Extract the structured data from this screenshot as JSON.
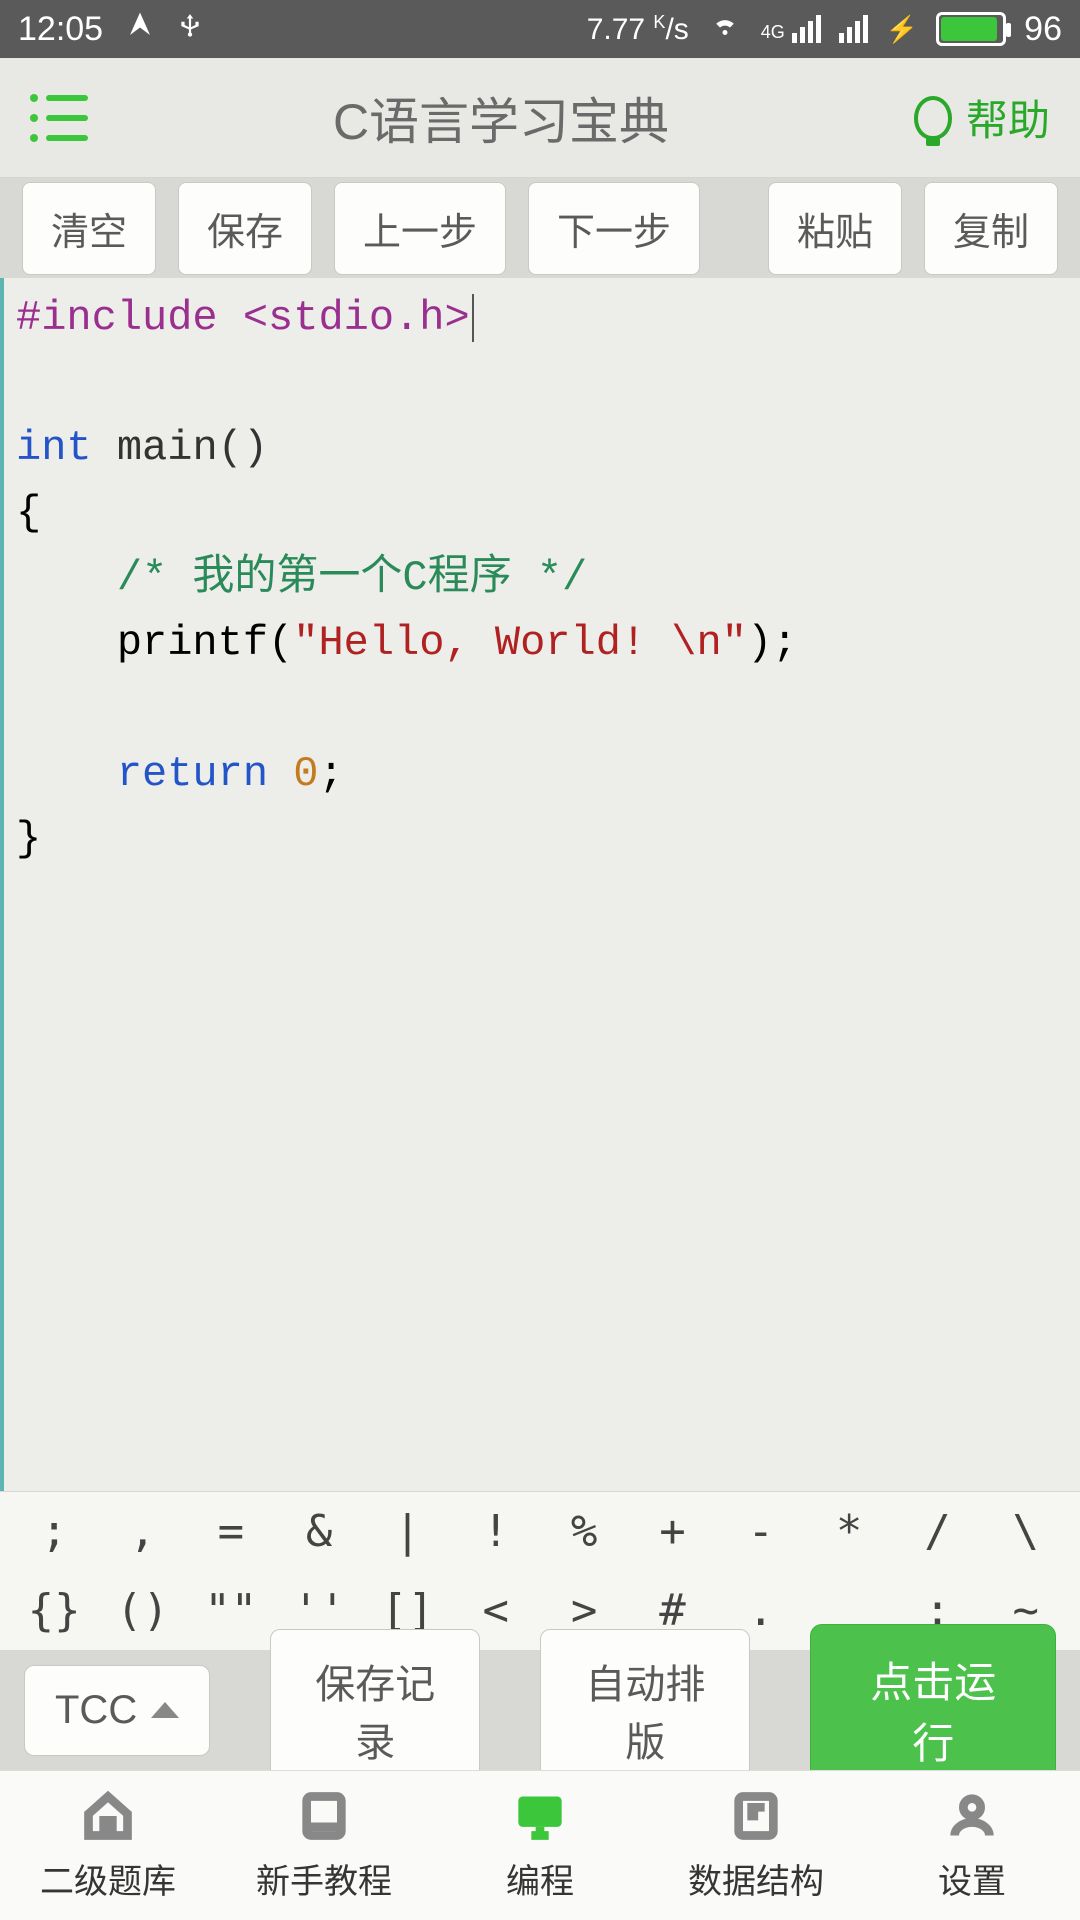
{
  "status": {
    "time": "12:05",
    "speed_val": "7.77",
    "speed_unit_top": "K",
    "speed_unit_bot": "/s",
    "network_label": "4G",
    "battery": "96"
  },
  "header": {
    "title": "C语言学习宝典",
    "help": "帮助"
  },
  "toolbar": {
    "clear": "清空",
    "save": "保存",
    "undo": "上一步",
    "redo": "下一步",
    "paste": "粘贴",
    "copy": "复制"
  },
  "code": {
    "l1a": "#include ",
    "l1b": "<stdio.h>",
    "l3a": "int",
    "l3b": " main()",
    "l4": "{",
    "l5": "    /* 我的第一个C程序 */",
    "l6a": "    printf(",
    "l6b": "\"Hello, World! \\n\"",
    "l6c": ");",
    "l8a": "    return ",
    "l8b": "0",
    "l8c": ";",
    "l9": "}"
  },
  "symbols": {
    "row1": [
      ";",
      ",",
      "=",
      "&",
      "|",
      "!",
      "%",
      "+",
      "-",
      "*",
      "/",
      "\\"
    ],
    "row2": [
      "{}",
      "()",
      "\"\"",
      "''",
      "[]",
      "<",
      ">",
      "#",
      ".",
      "_",
      ":",
      "~"
    ]
  },
  "actions": {
    "compiler": "TCC",
    "save_record": "保存记录",
    "auto_format": "自动排版",
    "run": "点击运行"
  },
  "nav": {
    "items": [
      {
        "label": "二级题库"
      },
      {
        "label": "新手教程"
      },
      {
        "label": "编程"
      },
      {
        "label": "数据结构"
      },
      {
        "label": "设置"
      }
    ]
  }
}
